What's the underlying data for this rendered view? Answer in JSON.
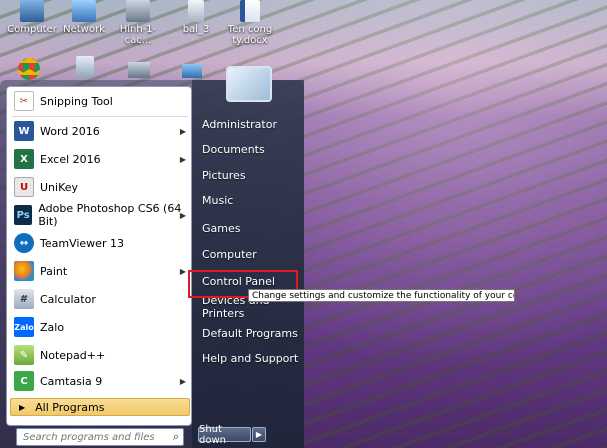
{
  "desktop_icons": [
    {
      "label": "Computer",
      "icon": "computer-icon"
    },
    {
      "label": "Network",
      "icon": "network-icon"
    },
    {
      "label": "Hinh-1-cac...",
      "icon": "image-file-icon"
    },
    {
      "label": "bai_3",
      "icon": "file-icon"
    },
    {
      "label": "Ten cong ty.docx",
      "icon": "word-doc-icon"
    }
  ],
  "programs": [
    {
      "label": "Snipping Tool",
      "icon": "scissors-icon",
      "has_arrow": false
    },
    {
      "label": "Word 2016",
      "icon": "word-icon",
      "has_arrow": true
    },
    {
      "label": "Excel 2016",
      "icon": "excel-icon",
      "has_arrow": true
    },
    {
      "label": "UniKey",
      "icon": "unikey-icon",
      "has_arrow": false
    },
    {
      "label": "Adobe Photoshop CS6 (64 Bit)",
      "icon": "photoshop-icon",
      "has_arrow": true
    },
    {
      "label": "TeamViewer 13",
      "icon": "teamviewer-icon",
      "has_arrow": false
    },
    {
      "label": "Paint",
      "icon": "paint-icon",
      "has_arrow": true
    },
    {
      "label": "Calculator",
      "icon": "calculator-icon",
      "has_arrow": false
    },
    {
      "label": "Zalo",
      "icon": "zalo-icon",
      "has_arrow": false
    },
    {
      "label": "Notepad++",
      "icon": "notepadpp-icon",
      "has_arrow": false
    },
    {
      "label": "Camtasia 9",
      "icon": "camtasia-icon",
      "has_arrow": true
    }
  ],
  "all_programs_label": "All Programs",
  "search": {
    "placeholder": "Search programs and files"
  },
  "right_items": [
    "Administrator",
    "Documents",
    "Pictures",
    "Music",
    "Games",
    "Computer",
    "Control Panel",
    "Devices and Printers",
    "Default Programs",
    "Help and Support"
  ],
  "tooltip": "Change settings and customize the functionality of your computer.",
  "shutdown_label": "Shut down",
  "colors": {
    "highlight_border": "#e0191f",
    "all_programs_bg": "#f0c969"
  }
}
